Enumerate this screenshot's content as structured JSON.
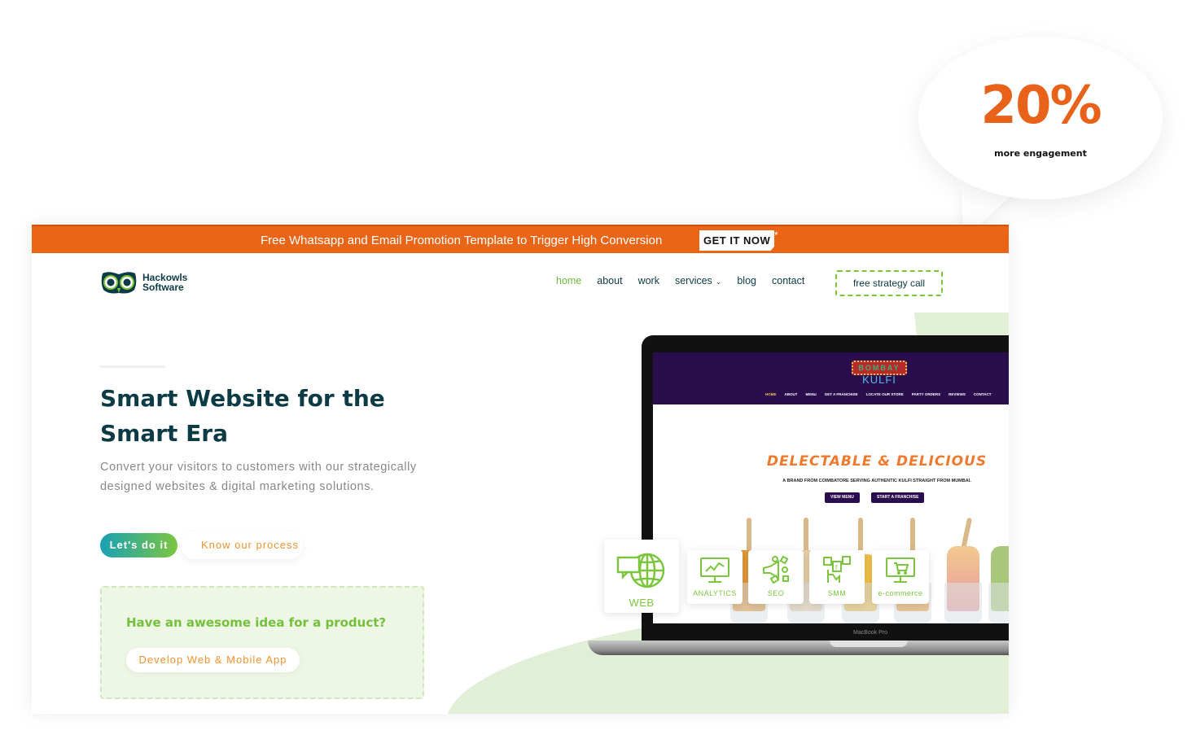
{
  "bubble": {
    "stat": "20%",
    "caption": "more engagement",
    "accent": "#e8621a"
  },
  "promo": {
    "text": "Free Whatsapp and Email Promotion Template to Trigger High Conversion",
    "button": "GET IT NOW",
    "asterisk": "*",
    "color": "#eb6517"
  },
  "header": {
    "logo_line1": "Hackowls",
    "logo_line2": "Software",
    "nav": [
      {
        "label": "home",
        "active": true
      },
      {
        "label": "about"
      },
      {
        "label": "work"
      },
      {
        "label": "services",
        "has_dropdown": true,
        "icon": "chevron-down-icon"
      },
      {
        "label": "blog"
      },
      {
        "label": "contact"
      }
    ],
    "cta": "free strategy call"
  },
  "hero": {
    "headline": "Smart Website for the Smart Era",
    "subtext": "Convert your visitors to customers with our strategically designed websites & digital marketing solutions.",
    "primary_button": "Let's do it",
    "secondary_button": "Know our process"
  },
  "idea_box": {
    "title": "Have an awesome idea for a product?",
    "button": "Develop Web & Mobile App"
  },
  "laptop": {
    "label": "MacBook Pro",
    "screen": {
      "logo_badge": "BOMBAY",
      "logo_text": "KULFI",
      "nav": [
        "HOME",
        "ABOUT",
        "MENU",
        "GET A FRANCHISE",
        "LOCATE OUR STORE",
        "PARTY ORDERS",
        "REVIEWS",
        "CONTACT"
      ],
      "headline": "DELECTABLE & DELICIOUS",
      "subtext": "A BRAND FROM COIMBATORE SERVING AUTHENTIC KULFI STRAIGHT FROM MUMBAI.",
      "buttons": [
        "VIEW MENU",
        "START A FRANCHISE"
      ]
    }
  },
  "services": [
    {
      "label": "WEB",
      "icon": "globe-chat-icon"
    },
    {
      "label": "ANALYTICS",
      "icon": "analytics-monitor-icon"
    },
    {
      "label": "SEO",
      "icon": "megaphone-icon"
    },
    {
      "label": "SMM",
      "icon": "social-media-icon"
    },
    {
      "label": "e-commerce",
      "icon": "shopping-cart-monitor-icon"
    }
  ],
  "colors": {
    "brand_dark": "#0c3a45",
    "brand_green": "#7cc63f",
    "brand_orange": "#f0932f"
  }
}
